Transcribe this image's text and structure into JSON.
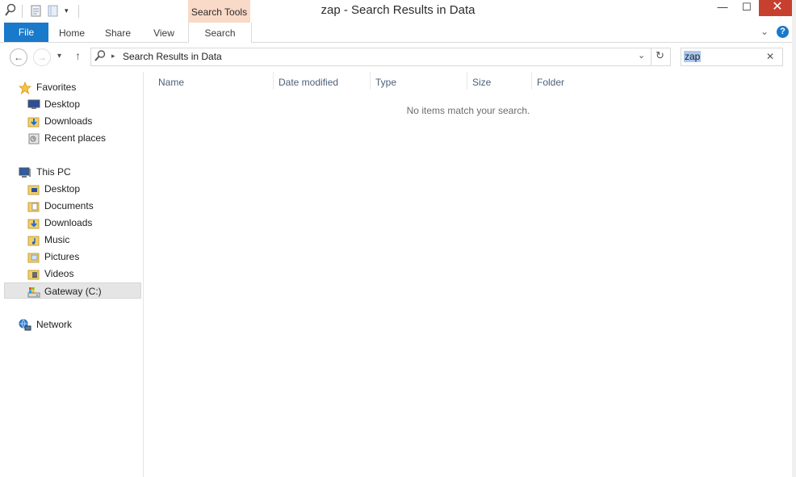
{
  "window": {
    "title": "zap - Search Results in Data",
    "context_tab": "Search Tools",
    "controls": {
      "minimize": "—",
      "maximize": "☐",
      "close": "✕"
    }
  },
  "ribbon": {
    "tabs": [
      {
        "label": "File",
        "active": true
      },
      {
        "label": "Home"
      },
      {
        "label": "Share"
      },
      {
        "label": "View"
      },
      {
        "label": "Search"
      }
    ],
    "help": "?"
  },
  "address_bar": {
    "path": "Search Results in Data",
    "back": "←",
    "forward": "→",
    "recent": "▾",
    "up": "↑",
    "refresh": "↻"
  },
  "search": {
    "value": "zap",
    "clear": "✕"
  },
  "nav_pane": {
    "favorites": {
      "label": "Favorites",
      "items": [
        "Desktop",
        "Downloads",
        "Recent places"
      ]
    },
    "this_pc": {
      "label": "This PC",
      "items": [
        "Desktop",
        "Documents",
        "Downloads",
        "Music",
        "Pictures",
        "Videos",
        "Gateway (C:)"
      ],
      "selected": "Gateway (C:)"
    },
    "network": {
      "label": "Network"
    }
  },
  "content": {
    "columns": [
      "Name",
      "Date modified",
      "Type",
      "Size",
      "Folder"
    ],
    "empty_message": "No items match your search."
  },
  "colors": {
    "file_tab": "#1979ca",
    "context_tab": "#f9d9c7",
    "close_button": "#c7402f",
    "selection": "#aac8ee",
    "column_header_text": "#4c607a"
  }
}
